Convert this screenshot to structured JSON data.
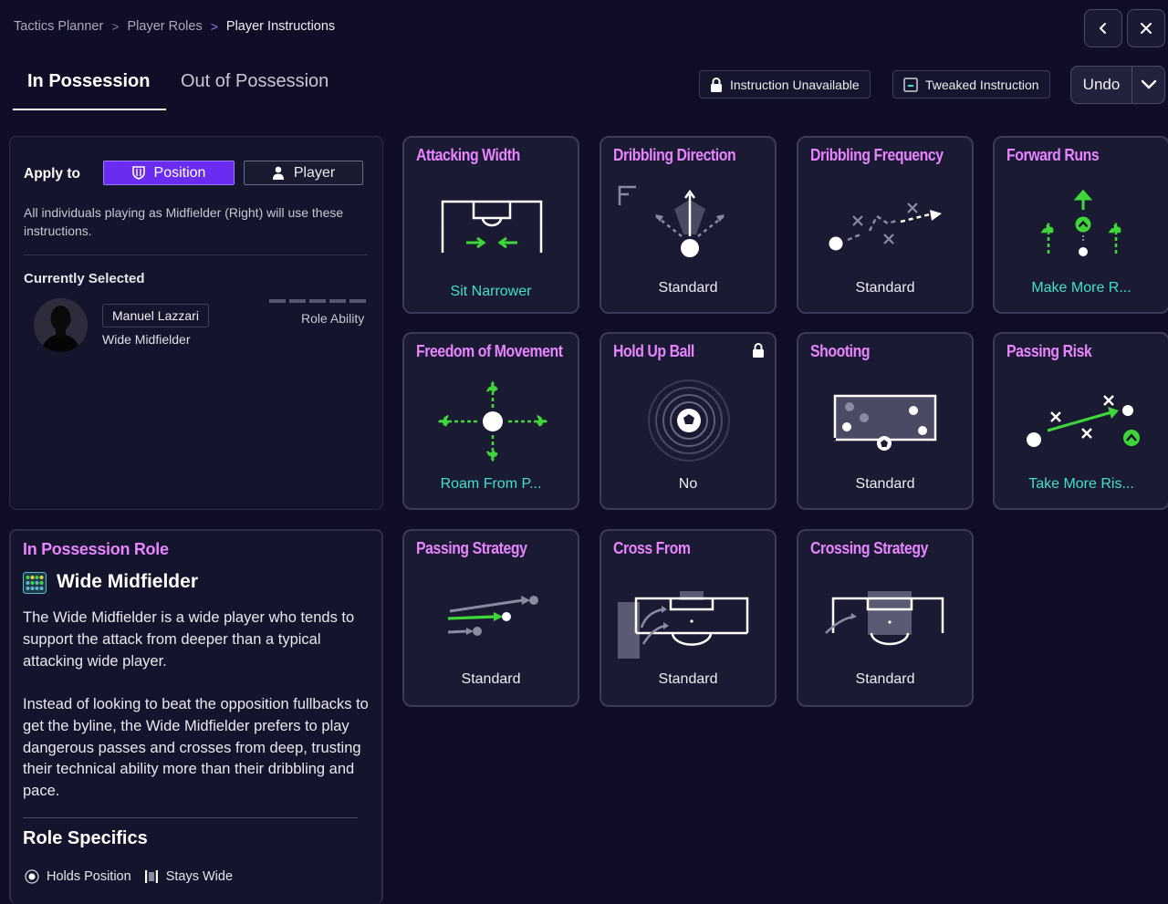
{
  "breadcrumb": {
    "items": [
      "Tactics Planner",
      "Player Roles",
      "Player Instructions"
    ]
  },
  "tabs": {
    "in_possession": "In Possession",
    "out_of_possession": "Out of Possession"
  },
  "legend": {
    "unavailable": "Instruction Unavailable",
    "tweaked": "Tweaked Instruction"
  },
  "undo": {
    "label": "Undo"
  },
  "apply": {
    "label": "Apply to",
    "position": "Position",
    "player": "Player",
    "description": "All individuals playing as Midfielder (Right) will use these instructions."
  },
  "selected": {
    "heading": "Currently Selected",
    "player_name": "Manuel Lazzari",
    "player_role": "Wide Midfielder",
    "role_ability_label": "Role Ability"
  },
  "role": {
    "heading": "In Possession Role",
    "title": "Wide Midfielder",
    "paragraph1": "The Wide Midfielder is a wide player who tends to support the attack from deeper than a typical attacking wide player.",
    "paragraph2": "Instead of looking to beat the opposition fullbacks to get the byline, the Wide Midfielder prefers to play dangerous passes and crosses from deep, trusting their technical ability more than their dribbling and pace.",
    "specifics_heading": "Role Specifics",
    "specifics": [
      "Holds Position",
      "Stays Wide"
    ]
  },
  "instructions": [
    {
      "title": "Attacking Width",
      "value": "Sit Narrower",
      "tweaked": true
    },
    {
      "title": "Dribbling Direction",
      "value": "Standard",
      "tweaked": false
    },
    {
      "title": "Dribbling Frequency",
      "value": "Standard",
      "tweaked": false
    },
    {
      "title": "Forward Runs",
      "value": "Make More R...",
      "tweaked": true
    },
    {
      "title": "Freedom of Movement",
      "value": "Roam From P...",
      "tweaked": true
    },
    {
      "title": "Hold Up Ball",
      "value": "No",
      "tweaked": false,
      "locked": true
    },
    {
      "title": "Shooting",
      "value": "Standard",
      "tweaked": false
    },
    {
      "title": "Passing Risk",
      "value": "Take More Ris...",
      "tweaked": true
    },
    {
      "title": "Passing Strategy",
      "value": "Standard",
      "tweaked": false
    },
    {
      "title": "Cross From",
      "value": "Standard",
      "tweaked": false
    },
    {
      "title": "Crossing Strategy",
      "value": "Standard",
      "tweaked": false
    }
  ],
  "colors": {
    "background": "#0f0e26",
    "accent_purple": "#6a2cf0",
    "title_pink": "#e884ff",
    "tweaked_teal": "#3fe0cc",
    "arrow_green": "#3fd63a"
  },
  "icons": [
    "chevron-left-icon",
    "close-icon",
    "padlock-icon",
    "tweaked-icon",
    "chevron-down-icon",
    "shield-icon",
    "person-icon",
    "ball-icon"
  ]
}
